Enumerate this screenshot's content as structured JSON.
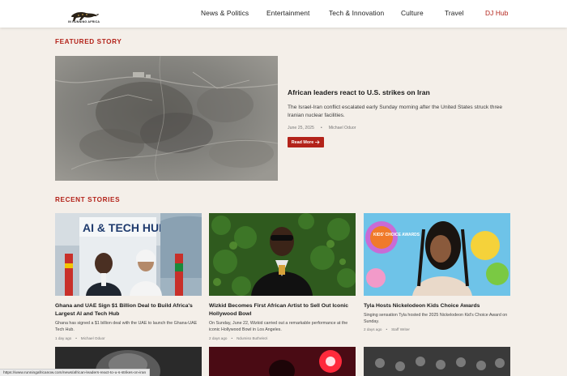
{
  "header": {
    "logo_text": "IN RUNNING AFRICA",
    "nav": [
      {
        "label": "News & Politics"
      },
      {
        "label": "Entertainment"
      },
      {
        "label": "Tech & Innovation"
      },
      {
        "label": "Culture"
      },
      {
        "label": "Travel"
      },
      {
        "label": "DJ Hub"
      }
    ]
  },
  "featured": {
    "heading": "FEATURED STORY",
    "title": "African leaders react to U.S. strikes on Iran",
    "excerpt": "The Israel-Iran conflict escalated early Sunday morning after the United States struck three Iranian nuclear facilities.",
    "date": "June 25, 2025",
    "author": "Michael Oduor",
    "read_more": "Read More",
    "read_more_icon": "arrow-right-icon"
  },
  "recent": {
    "heading": "RECENT STORIES",
    "cards": [
      {
        "title": "Ghana and UAE Sign $1 Billion Deal to Build Africa's Largest AI and Tech Hub",
        "excerpt": "Ghana has signed a $1 billion deal with the UAE to launch the Ghana-UAE Tech Hub.",
        "time": "1 day ago",
        "author": "Michael Oduor",
        "image_sign": "AI & TECH HUB"
      },
      {
        "title": "Wizkid Becomes First African Artist to Sell Out Iconic Hollywood Bowl",
        "excerpt": "On Sunday, June 22, Wizkid carried out a remarkable performance at the iconic Hollywood Bowl in Los Angeles.",
        "time": "2 days ago",
        "author": "Ndumiso Buthelezi"
      },
      {
        "title": "Tyla Hosts Nickelodeon Kids Choice Awards",
        "excerpt": "Singing sensation Tyla hosted the 2025 Nickelodeon Kid's Choice Award on Sunday.",
        "time": "2 days ago",
        "author": "Staff Writer",
        "image_sign": "KIDS' CHOICE AWARDS"
      }
    ]
  },
  "status_bar": {
    "url": "https://www.runningafricanow.com/news/african-leaders-react-to-u-s-strikes-on-iran"
  },
  "colors": {
    "accent": "#b3231a",
    "background": "#f4efe9"
  }
}
